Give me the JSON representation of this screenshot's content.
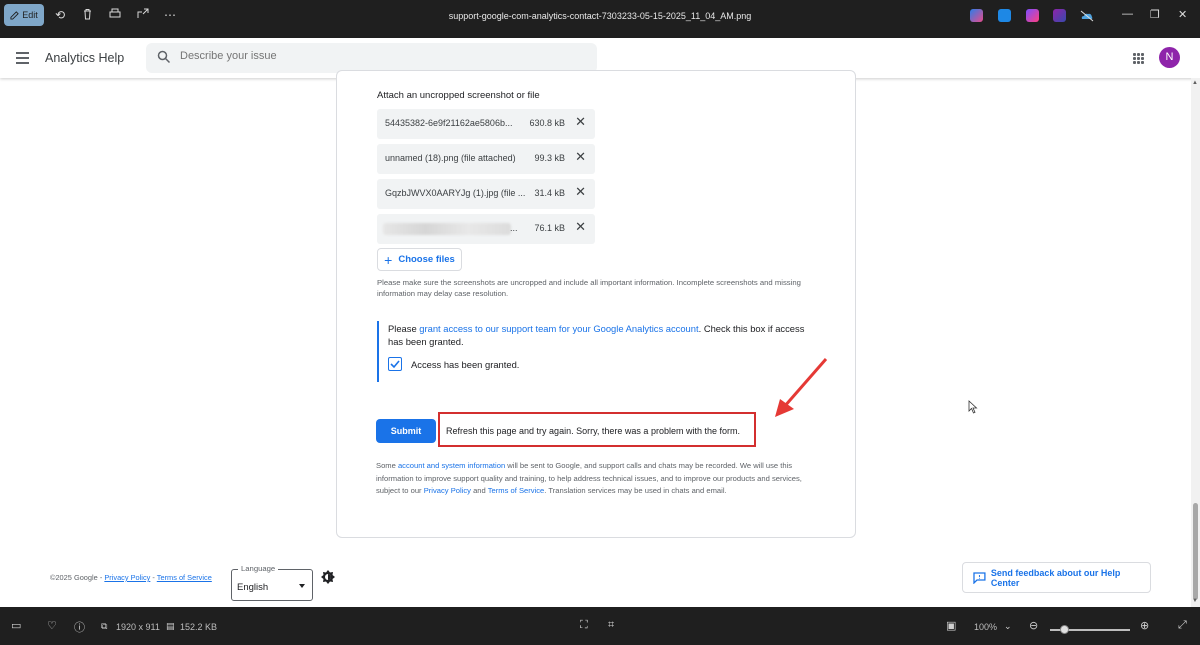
{
  "viewer": {
    "edit_label": "Edit",
    "file_title": "support-google-com-analytics-contact-7303233-05-15-2025_11_04_AM.png",
    "image_dims": "1920 x 911",
    "file_size": "152.2 KB",
    "zoom": "100%"
  },
  "header": {
    "title": "Analytics Help",
    "search_placeholder": "Describe your issue",
    "avatar_initial": "N"
  },
  "form": {
    "attach_label": "Attach an uncropped screenshot or file",
    "files": [
      {
        "name": "54435382-6e9f21162ae5806b...",
        "size": "630.8 kB"
      },
      {
        "name": "unnamed (18).png (file attached)",
        "size": "99.3 kB"
      },
      {
        "name": "GqzbJWVX0AARYJg (1).jpg (file ...",
        "size": "31.4 kB"
      },
      {
        "name": "...",
        "size": "76.1 kB"
      }
    ],
    "choose_files": "Choose files",
    "hint": "Please make sure the screenshots are uncropped and include all important information. Incomplete screenshots and missing information may delay case resolution.",
    "grant_prefix": "Please ",
    "grant_link": "grant access to our support team for your Google Analytics account",
    "grant_suffix": ". Check this box if access has been granted.",
    "checkbox_label": "Access has been granted.",
    "submit": "Submit",
    "error": "Refresh this page and try again. Sorry, there was a problem with the form.",
    "privacy_1": "Some ",
    "privacy_link_1": "account and system information",
    "privacy_2": " will be sent to Google, and support calls and chats may be recorded. We will use this information to improve support quality and training, to help address technical issues, and to improve our products and services, subject to our ",
    "privacy_link_2": "Privacy Policy",
    "privacy_3": " and ",
    "privacy_link_3": "Terms of Service",
    "privacy_4": ". Translation services may be used in chats and email."
  },
  "footer": {
    "copyright": "©2025 Google - ",
    "privacy": "Privacy Policy",
    "sep": " - ",
    "terms": "Terms of Service",
    "language_legend": "Language",
    "language_value": "English",
    "feedback": "Send feedback about our Help Center"
  },
  "colors": {
    "accent": "#1a73e8",
    "error_border": "#d32f2f",
    "avatar": "#8e24aa"
  }
}
